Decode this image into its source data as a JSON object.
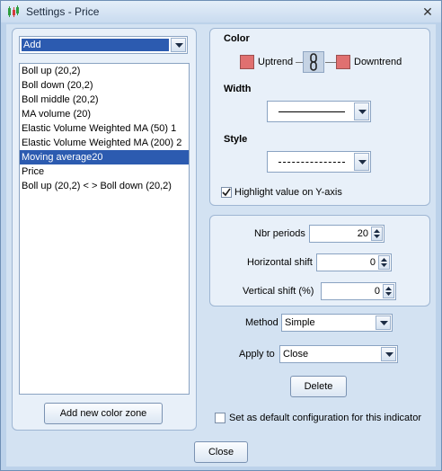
{
  "window": {
    "title": "Settings - Price"
  },
  "left": {
    "add_combo_value": "Add",
    "items": [
      "Boll up (20,2)",
      "Boll down (20,2)",
      "Boll middle (20,2)",
      "MA volume (20)",
      "Elastic Volume Weighted MA (50) 1",
      "Elastic Volume Weighted MA (200) 2",
      "Moving average20",
      "Price",
      "Boll up (20,2) < > Boll down (20,2)"
    ],
    "selected_index": 6,
    "add_color_zone_label": "Add new color zone"
  },
  "appearance": {
    "color_label": "Color",
    "uptrend_label": "Uptrend",
    "downtrend_label": "Downtrend",
    "uptrend_color": "#e07070",
    "downtrend_color": "#e07070",
    "width_label": "Width",
    "style_label": "Style",
    "highlight_label": "Highlight value on Y-axis",
    "highlight_checked": true
  },
  "params": {
    "nbr_periods_label": "Nbr periods",
    "nbr_periods_value": "20",
    "horizontal_shift_label": "Horizontal shift",
    "horizontal_shift_value": "0",
    "vertical_shift_label": "Vertical shift (%)",
    "vertical_shift_value": "0"
  },
  "method": {
    "label": "Method",
    "value": "Simple"
  },
  "apply_to": {
    "label": "Apply to",
    "value": "Close"
  },
  "delete_label": "Delete",
  "default_config_label": "Set as default configuration for this indicator",
  "default_config_checked": false,
  "close_label": "Close"
}
